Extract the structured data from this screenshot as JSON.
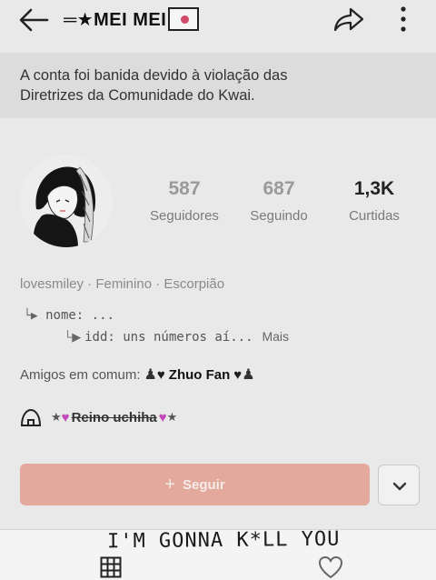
{
  "header": {
    "title": "═★MEI MEI",
    "icons": {
      "back": "arrow-left-icon",
      "share": "share-arrow-icon",
      "more": "vertical-dots-icon",
      "flag": "japan-flag-icon"
    }
  },
  "banner": {
    "line1": "A conta foi banida devido à violação das",
    "line2": "Diretrizes da Comunidade do Kwai."
  },
  "stats": [
    {
      "value": "587",
      "label": "Seguidores"
    },
    {
      "value": "687",
      "label": "Seguindo"
    },
    {
      "value": "1,3K",
      "label": "Curtidas"
    }
  ],
  "profile": {
    "meta": "lovesmiley · Feminino · Escorpião",
    "bio_line1": "nome: ...",
    "bio_line2": "idd: uns números aí...",
    "more_label": "Mais",
    "mutual_label": "Amigos em comum:",
    "mutual_name": "Zhuo Fan",
    "family_name": "Reino uchiha"
  },
  "actions": {
    "follow_label": "Seguir"
  },
  "overlay": {
    "caption": "I'M GONNA K*LL YOU"
  },
  "colors": {
    "follow_button": "#e2a99c",
    "banner_bg": "#dcdcdc",
    "page_bg": "#e9e9e9"
  }
}
